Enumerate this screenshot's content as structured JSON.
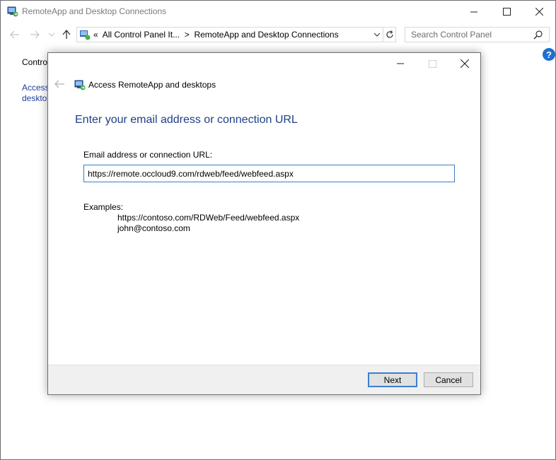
{
  "window": {
    "title": "RemoteApp and Desktop Connections"
  },
  "navbar": {
    "breadcrumb_prefix": "«",
    "breadcrumb_parent": "All Control Panel It...",
    "breadcrumb_sep": ">",
    "breadcrumb_current": "RemoteApp and Desktop Connections",
    "search_placeholder": "Search Control Panel"
  },
  "sidebar": {
    "link1": "Contro",
    "link2_line1": "Access",
    "link2_line2": "desktop"
  },
  "dialog": {
    "title": "Access RemoteApp and desktops",
    "heading": "Enter your email address or connection URL",
    "field_label": "Email address or connection URL:",
    "field_value": "https://remote.occloud9.com/rdweb/feed/webfeed.aspx",
    "examples_label": "Examples:",
    "examples": [
      "https://contoso.com/RDWeb/Feed/webfeed.aspx",
      "john@contoso.com"
    ],
    "next_label": "Next",
    "cancel_label": "Cancel"
  },
  "colors": {
    "heading": "#1e3f86",
    "link": "#1f3e9b",
    "input_border": "#3d7dc7",
    "help_icon": "#1e6fce"
  }
}
